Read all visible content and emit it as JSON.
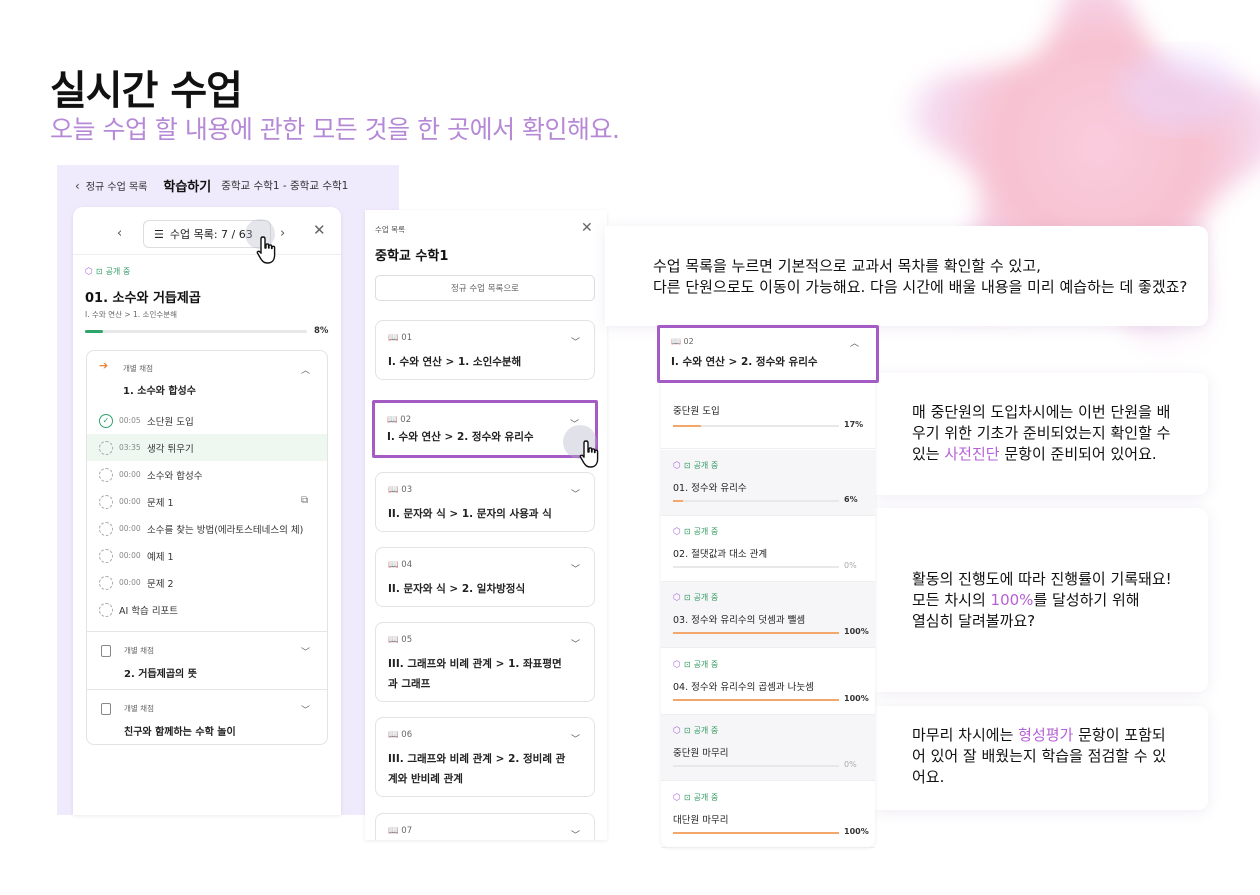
{
  "hero": {
    "title": "실시간 수업",
    "subtitle": "오늘 수업 할 내용에 관한 모든 것을 한 곳에서 확인해요."
  },
  "colors": {
    "accent": "#b661d6",
    "highlight_border": "#a55bc4",
    "green": "#2fa56a",
    "orange_bar": "#f4a76a"
  },
  "panel1": {
    "back_label": "정규 수업 목록",
    "study_label": "학습하기",
    "path": "중학교 수학1 - 중학교 수학1",
    "lesson_list_label": "수업 목록: 7 / 63",
    "badge": "공개 중",
    "lesson_title": "01. 소수와 거듭제곱",
    "breadcrumb": "I. 수와 연산 > 1. 소인수분해",
    "progress_label": "8%",
    "progress": 0.08,
    "section1": {
      "small": "개별 채점",
      "name": "1. 소수와 합성수",
      "items": [
        {
          "time": "00:05",
          "label": "소단원 도입",
          "done": true
        },
        {
          "time": "03:35",
          "label": "생각 튀우기",
          "highlight": true
        },
        {
          "time": "00:00",
          "label": "소수와 합성수"
        },
        {
          "time": "00:00",
          "label": "문제 1",
          "doc": true
        },
        {
          "time": "00:00",
          "label": "소수를 찾는 방법(에라토스테네스의 체)"
        },
        {
          "time": "00:00",
          "label": "예제 1"
        },
        {
          "time": "00:00",
          "label": "문제 2"
        },
        {
          "time": "",
          "label": "AI 학습 리포트"
        }
      ]
    },
    "section2": {
      "small": "개별 채점",
      "name": "2. 거듭제곱의 뜻"
    },
    "section3": {
      "small": "개별 채점",
      "name": "친구와 함께하는 수학 놀이"
    }
  },
  "panel2": {
    "label": "수업 목록",
    "title": "중학교 수학1",
    "regular_button": "정규 수업 목록으로",
    "units": [
      {
        "num": "01",
        "name": "I. 수와 연산 > 1. 소인수분해"
      },
      {
        "num": "02",
        "name": "I. 수와 연산 > 2. 정수와 유리수",
        "selected": true
      },
      {
        "num": "03",
        "name": "II. 문자와 식 > 1. 문자의 사용과 식"
      },
      {
        "num": "04",
        "name": "II. 문자와 식 > 2. 일차방정식"
      },
      {
        "num": "05",
        "name": "III. 그래프와 비례 관계 > 1. 좌표평면과 그래프"
      },
      {
        "num": "06",
        "name": "III. 그래프와 비례 관계 > 2. 정비례 관계와 반비례 관계"
      },
      {
        "num": "07",
        "name": ""
      }
    ]
  },
  "panel3": {
    "unit_num": "02",
    "unit_name": "I. 수와 연산 > 2. 정수와 유리수",
    "lessons": [
      {
        "name": "중단원 도입",
        "pct": "17%",
        "value": 0.17,
        "badge": false
      },
      {
        "name": "01. 정수와 유리수",
        "pct": "6%",
        "value": 0.06,
        "badge": true
      },
      {
        "name": "02. 절댓값과 대소 관계",
        "pct": "0%",
        "value": 0,
        "badge": true
      },
      {
        "name": "03. 정수와 유리수의 덧셈과 뺄셈",
        "pct": "100%",
        "value": 1,
        "badge": true
      },
      {
        "name": "04. 정수와 유리수의 곱셈과 나눗셈",
        "pct": "100%",
        "value": 1,
        "badge": true
      },
      {
        "name": "중단원 마무리",
        "pct": "0%",
        "value": 0,
        "badge": true
      },
      {
        "name": "대단원 마무리",
        "pct": "100%",
        "value": 1,
        "badge": true
      }
    ]
  },
  "callouts": {
    "c1_line1": "수업 목록을 누르면 기본적으로 교과서 목차를 확인할 수 있고,",
    "c1_line2": "다른 단원으로도 이동이 가능해요. 다음 시간에 배울 내용을 미리 예습하는 데 좋겠죠?",
    "c2_pre": "매 중단원의 도입차시에는 이번 단원을 배우기 위한 기초가 준비되었는지 확인할 수 있는 ",
    "c2_accent": "사전진단",
    "c2_post": " 문항이 준비되어 있어요.",
    "c3_line1": "활동의 진행도에 따라 진행률이 기록돼요!",
    "c3_pre": "모든 차시의 ",
    "c3_accent": "100%",
    "c3_post": "를 달성하기 위해",
    "c3_line3": "열심히 달려볼까요?",
    "c4_pre": "마무리 차시에는 ",
    "c4_accent": "형성평가",
    "c4_post": " 문항이 포함되어 있어 잘 배웠는지 학습을 점검할 수 있어요."
  }
}
